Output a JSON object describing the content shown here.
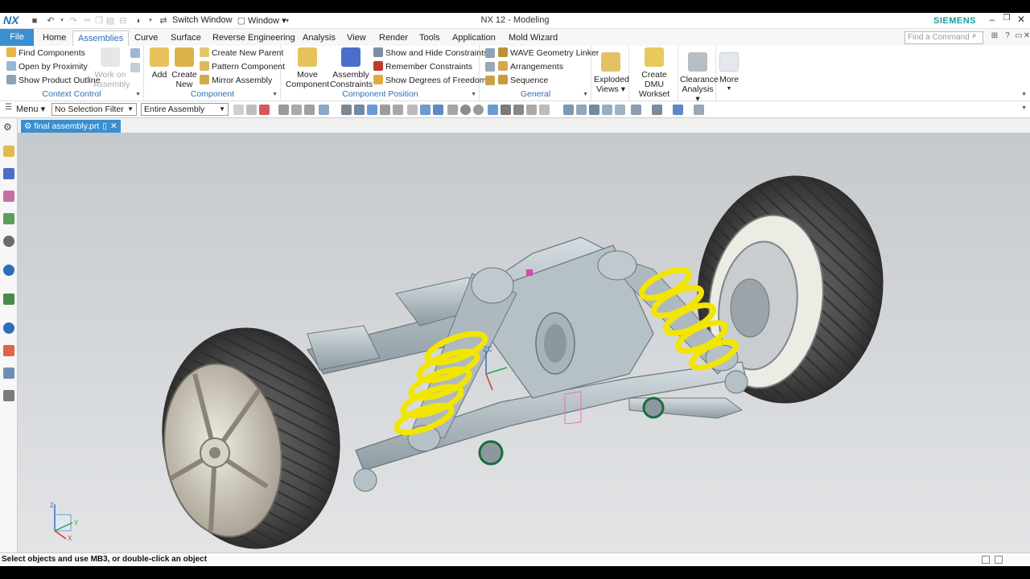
{
  "titlebar": {
    "logo": "NX",
    "switch_window": "Switch Window",
    "window_menu": "Window ▾",
    "title": "NX 12 - Modeling",
    "brand": "SIEMENS"
  },
  "tabs": [
    {
      "label": "File"
    },
    {
      "label": "Home"
    },
    {
      "label": "Assemblies"
    },
    {
      "label": "Curve"
    },
    {
      "label": "Surface"
    },
    {
      "label": "Reverse Engineering"
    },
    {
      "label": "Analysis"
    },
    {
      "label": "View"
    },
    {
      "label": "Render"
    },
    {
      "label": "Tools"
    },
    {
      "label": "Application"
    },
    {
      "label": "Mold Wizard"
    }
  ],
  "search": {
    "placeholder": "Find a Command"
  },
  "ribbon": {
    "context_control": {
      "label": "Context Control",
      "find_components": "Find Components",
      "open_by_proximity": "Open by Proximity",
      "show_product_outline": "Show Product Outline",
      "work_on_assembly_1": "Work on",
      "work_on_assembly_2": "Assembly"
    },
    "component": {
      "label": "Component",
      "add": "Add",
      "create_new_1": "Create",
      "create_new_2": "New",
      "create_new_parent": "Create New Parent",
      "pattern_component": "Pattern Component",
      "mirror_assembly": "Mirror Assembly"
    },
    "component_position": {
      "label": "Component Position",
      "move_component_1": "Move",
      "move_component_2": "Component",
      "assembly_constraints_1": "Assembly",
      "assembly_constraints_2": "Constraints",
      "show_hide_constraints": "Show and Hide Constraints",
      "remember_constraints": "Remember Constraints",
      "show_degrees_of_freedom": "Show Degrees of Freedom"
    },
    "general": {
      "label": "General",
      "wave_geometry_linker": "WAVE Geometry Linker",
      "arrangements": "Arrangements",
      "sequence": "Sequence"
    },
    "exploded_views_1": "Exploded",
    "exploded_views_2": "Views ▾",
    "create_dmu_1": "Create DMU",
    "create_dmu_2": "Workset",
    "clearance_1": "Clearance",
    "clearance_2": "Analysis ▾",
    "more": "More"
  },
  "selection": {
    "menu": "Menu ▾",
    "filter": "No Selection Filter",
    "scope": "Entire Assembly"
  },
  "document": {
    "tab": "final assembly.prt"
  },
  "triad": {
    "x": "X",
    "y": "Y",
    "z": "Z"
  },
  "status": {
    "text": "Select objects and use MB3, or double-click an object"
  },
  "colors": {
    "accent": "#3a8fd0",
    "spring": "#f2e600",
    "part": "#b9c4ca",
    "tire": "#4a4a4a"
  }
}
